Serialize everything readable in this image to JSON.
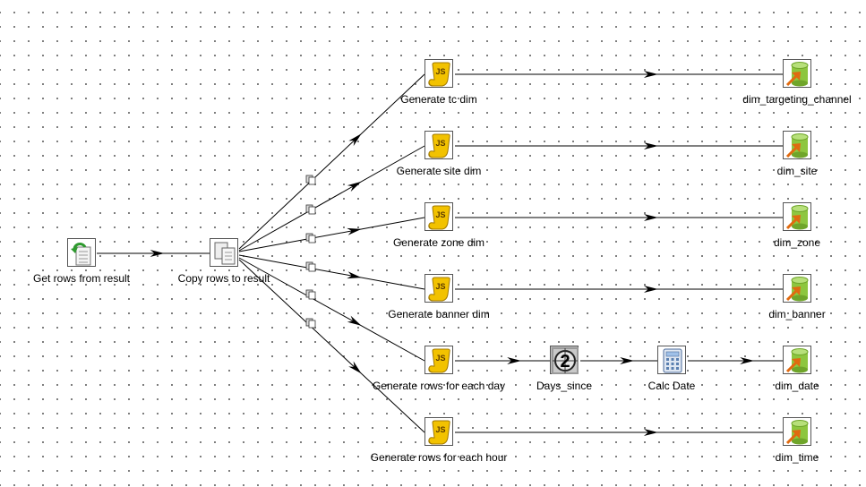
{
  "steps": {
    "get_rows": "Get rows from result",
    "copy_rows": "Copy rows to result",
    "gen_tc": "Generate tc dim",
    "gen_site": "Generate site dim",
    "gen_zone": "Generate zone dim",
    "gen_banner": "Generate banner dim",
    "gen_day": "Generate rows for each day",
    "days_since": "Days_since",
    "calc_date": "Calc Date",
    "gen_hour": "Generate rows for each hour",
    "dim_tc": "dim_targeting_channel",
    "dim_site": "dim_site",
    "dim_zone": "dim_zone",
    "dim_banner": "dim_banner",
    "dim_date": "dim_date",
    "dim_time": "dim_time"
  },
  "icons": {
    "get_rows": "get-rows-icon",
    "copy_rows": "copy-rows-icon",
    "script": "javascript-icon",
    "sequence": "sequence-icon",
    "calculator": "calculator-icon",
    "table_output": "table-output-icon",
    "copy_hop": "copy-hop-icon"
  },
  "digits": {
    "days_since": "2"
  },
  "colors": {
    "hop_line": "#000000",
    "script_yellow": "#f2c200",
    "db_green": "#8dc63f",
    "db_arrow": "#e06a10",
    "grid_dot": "#5a5a5a"
  }
}
